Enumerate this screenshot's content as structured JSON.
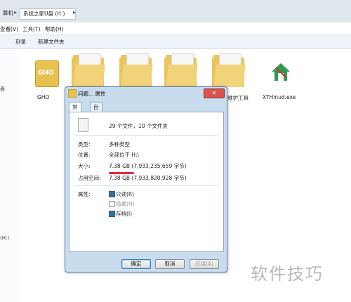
{
  "explorer": {
    "breadcrumb": [
      "算机",
      "系统之家U盘 (H:)"
    ],
    "menu": [
      "查看(V)",
      "工具(T)",
      "帮助(H)"
    ],
    "toolbar": [
      "刻录",
      "新建文件夹"
    ],
    "nav_labels": [
      "盘",
      "(H:)"
    ],
    "files": [
      {
        "name": "GHO",
        "type": "gho"
      },
      {
        "name": "",
        "type": "folder"
      },
      {
        "name": "",
        "type": "folder"
      },
      {
        "name": "",
        "type": "folder"
      },
      {
        "name": "维护工具",
        "type": "folder"
      },
      {
        "name": "XTHinud.exe",
        "type": "exe"
      }
    ]
  },
  "dialog": {
    "title": "问题... 属性",
    "close_label": "✕",
    "tabs": [
      "常规",
      "自定义"
    ],
    "summary": "29 个文件，10 个文件夹",
    "fields": [
      {
        "label": "类型:",
        "value": "多种类型"
      },
      {
        "label": "位置:",
        "value": "全部位于 H:\\"
      },
      {
        "label": "大小:",
        "value": "7.38 GB (7,933,235,659 字节)"
      },
      {
        "label": "占用空间:",
        "value": "7.38 GB (7,933,820,928 字节)"
      }
    ],
    "attributes_label": "属性:",
    "attributes": [
      {
        "label": "只读(R)",
        "checked": true
      },
      {
        "label": "隐藏(H)",
        "checked": false
      },
      {
        "label": "存档(I)",
        "checked": true
      }
    ],
    "buttons": {
      "ok": "确定",
      "cancel": "取消",
      "apply": "应用(A)"
    }
  },
  "watermark": "软件技巧",
  "colors": {
    "accent": "#3c7fb1",
    "highlight_line": "#e0263f"
  }
}
